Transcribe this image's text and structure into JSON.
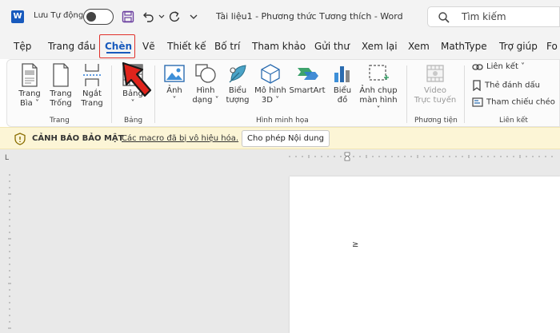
{
  "titlebar": {
    "app_icon_letter": "W",
    "autosave_label": "Lưu Tự động",
    "doc_title": "Tài liệu1  -  Phương thức Tương thích  -  Word",
    "search_placeholder": "Tìm kiếm"
  },
  "tabs": [
    {
      "label": "Tệp"
    },
    {
      "label": "Trang đầu"
    },
    {
      "label": "Chèn"
    },
    {
      "label": "Vẽ"
    },
    {
      "label": "Thiết kế"
    },
    {
      "label": "Bố trí"
    },
    {
      "label": "Tham khảo"
    },
    {
      "label": "Gửi thư"
    },
    {
      "label": "Xem lại"
    },
    {
      "label": "Xem"
    },
    {
      "label": "MathType"
    },
    {
      "label": "Trợ giúp"
    },
    {
      "label": "Fo"
    }
  ],
  "ribbon": {
    "pages": {
      "cover": [
        "Trang",
        "Bìa ˅"
      ],
      "blank": [
        "Trang",
        "Trống"
      ],
      "break": [
        "Ngắt",
        "Trang"
      ],
      "group_label": "Trang"
    },
    "tables": {
      "table": [
        "Bảng",
        "˅"
      ],
      "group_label": "Bảng"
    },
    "illustrations": {
      "pictures": [
        "Ảnh",
        "˅"
      ],
      "shapes": [
        "Hình",
        "dạng ˅"
      ],
      "icons": [
        "Biểu",
        "tượng"
      ],
      "models": [
        "Mô hình",
        "3D ˅"
      ],
      "smartart": "SmartArt",
      "chart": [
        "Biểu",
        "đồ"
      ],
      "screenshot": [
        "Ảnh chụp",
        "màn hình ˅"
      ],
      "group_label": "Hình minh họa"
    },
    "media": {
      "video": [
        "Video",
        "Trực tuyến"
      ],
      "group_label": "Phương tiện"
    },
    "links": {
      "link": "Liên kết  ˅",
      "bookmark": "Thẻ đánh dấu",
      "crossref": "Tham chiếu chéo",
      "group_label": "Liên kết"
    }
  },
  "security_bar": {
    "title": "CẢNH BÁO BẢO MẬT",
    "message": "Các macro đã bị vô hiệu hóa.",
    "button": "Cho phép Nội dung"
  },
  "document": {
    "ruler_corner": "L",
    "paragraph_mark": "≥"
  },
  "colors": {
    "accent": "#185abd",
    "highlight_box": "#e0302a",
    "warning_bg": "#fcf5d6"
  }
}
